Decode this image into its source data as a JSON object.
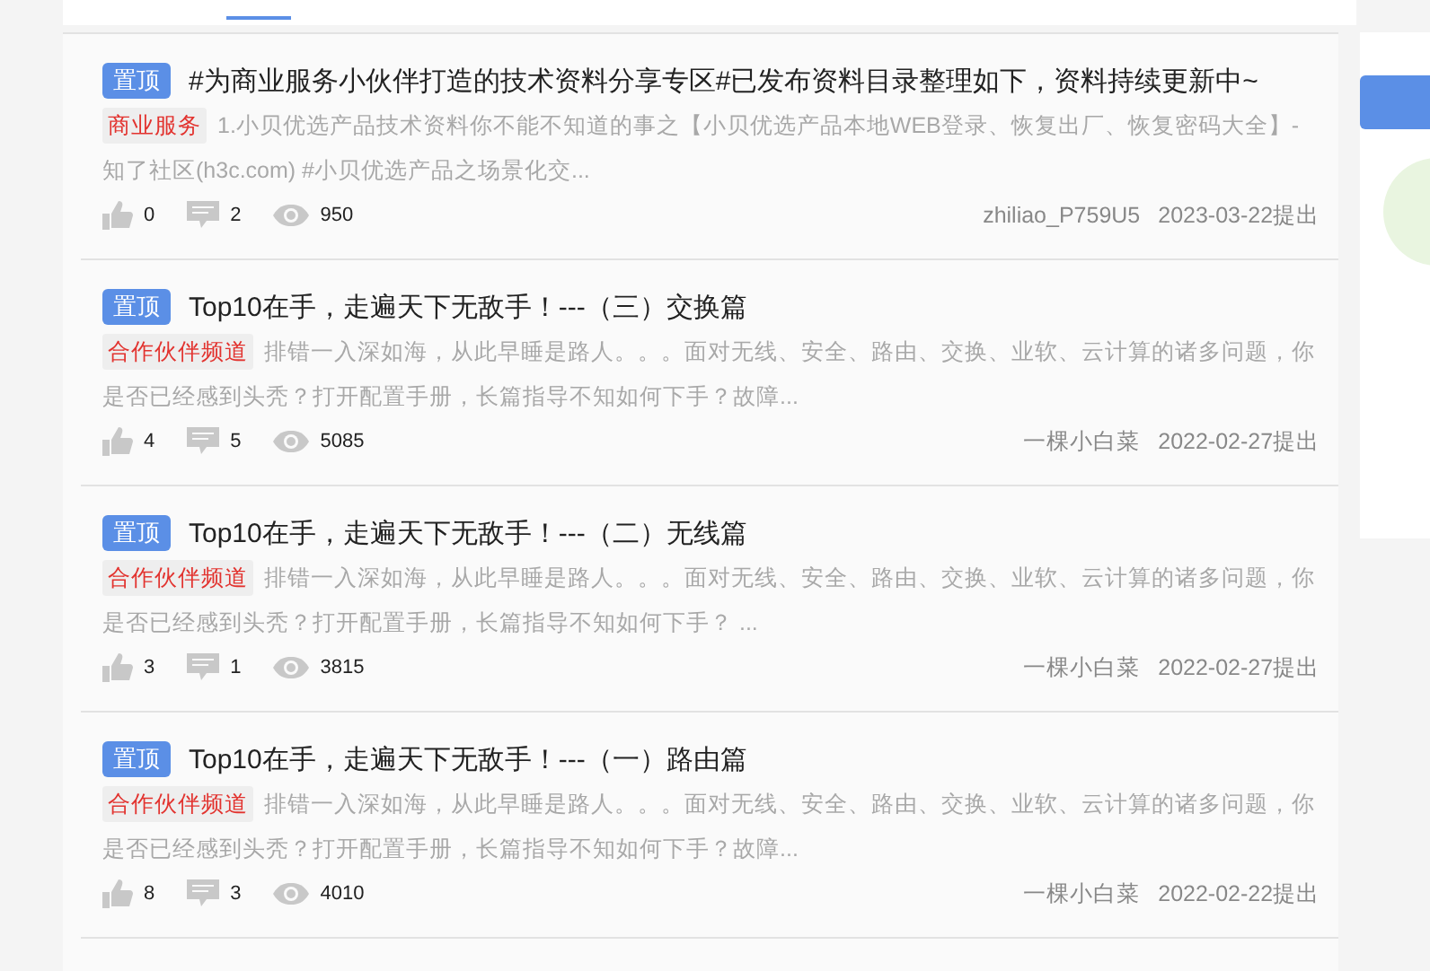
{
  "posts": [
    {
      "badge": "置顶",
      "title": "#为商业服务小伙伴打造的技术资料分享专区#已发布资料目录整理如下，资料持续更新中~",
      "tag": "商业服务",
      "summary": "1.小贝优选产品技术资料你不能不知道的事之【小贝优选产品本地WEB登录、恢复出厂、恢复密码大全】-知了社区(h3c.com) #小贝优选产品之场景化交...",
      "likes": "0",
      "comments": "2",
      "views": "950",
      "author": "zhiliao_P759U5",
      "date": "2023-03-22提出"
    },
    {
      "badge": "置顶",
      "title": "Top10在手，走遍天下无敌手！---（三）交换篇",
      "tag": "合作伙伴频道",
      "summary": "排错一入深如海，从此早睡是路人。。。面对无线、安全、路由、交换、业软、云计算的诸多问题，你是否已经感到头秃？打开配置手册，长篇指导不知如何下手？故障...",
      "likes": "4",
      "comments": "5",
      "views": "5085",
      "author": "一棵小白菜",
      "date": "2022-02-27提出"
    },
    {
      "badge": "置顶",
      "title": "Top10在手，走遍天下无敌手！---（二）无线篇",
      "tag": "合作伙伴频道",
      "summary": "排错一入深如海，从此早睡是路人。。。面对无线、安全、路由、交换、业软、云计算的诸多问题，你是否已经感到头秃？打开配置手册，长篇指导不知如何下手？ ...",
      "likes": "3",
      "comments": "1",
      "views": "3815",
      "author": "一棵小白菜",
      "date": "2022-02-27提出"
    },
    {
      "badge": "置顶",
      "title": "Top10在手，走遍天下无敌手！---（一）路由篇",
      "tag": "合作伙伴频道",
      "summary": "排错一入深如海，从此早睡是路人。。。面对无线、安全、路由、交换、业软、云计算的诸多问题，你是否已经感到头秃？打开配置手册，长篇指导不知如何下手？故障...",
      "likes": "8",
      "comments": "3",
      "views": "4010",
      "author": "一棵小白菜",
      "date": "2022-02-22提出"
    }
  ]
}
